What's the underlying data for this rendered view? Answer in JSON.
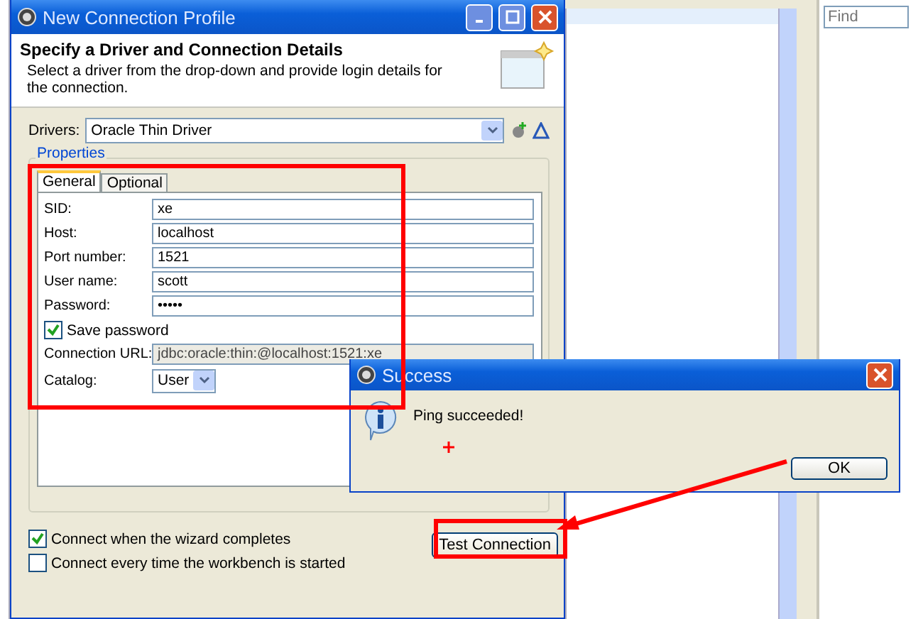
{
  "dialog": {
    "title": "New Connection Profile",
    "heading": "Specify a Driver and Connection Details",
    "description": "Select a driver from the drop-down and provide login details for the connection.",
    "drivers_label": "Drivers:",
    "driver": "Oracle Thin Driver",
    "group_label": "Properties",
    "tabs": [
      {
        "label": "General",
        "selected": true
      },
      {
        "label": "Optional",
        "selected": false
      }
    ],
    "fields": [
      {
        "label": "SID:",
        "value": "xe"
      },
      {
        "label": "Host:",
        "value": "localhost"
      },
      {
        "label": "Port number:",
        "value": "1521"
      },
      {
        "label": "User name:",
        "value": "scott"
      },
      {
        "label": "Password:",
        "value": "•••••"
      }
    ],
    "save_password": {
      "label": "Save password",
      "checked": true
    },
    "connection_url": {
      "label": "Connection URL:",
      "value": "jdbc:oracle:thin:@localhost:1521:xe"
    },
    "catalog": {
      "label": "Catalog:",
      "value": "User"
    },
    "options": [
      {
        "label": "Connect when the wizard completes",
        "checked": true
      },
      {
        "label": "Connect every time the workbench is started",
        "checked": false
      }
    ],
    "test_button": "Test Connection"
  },
  "search": {
    "placeholder": "Find"
  },
  "message_box": {
    "title": "Success",
    "message": "Ping succeeded!",
    "button": "OK"
  }
}
